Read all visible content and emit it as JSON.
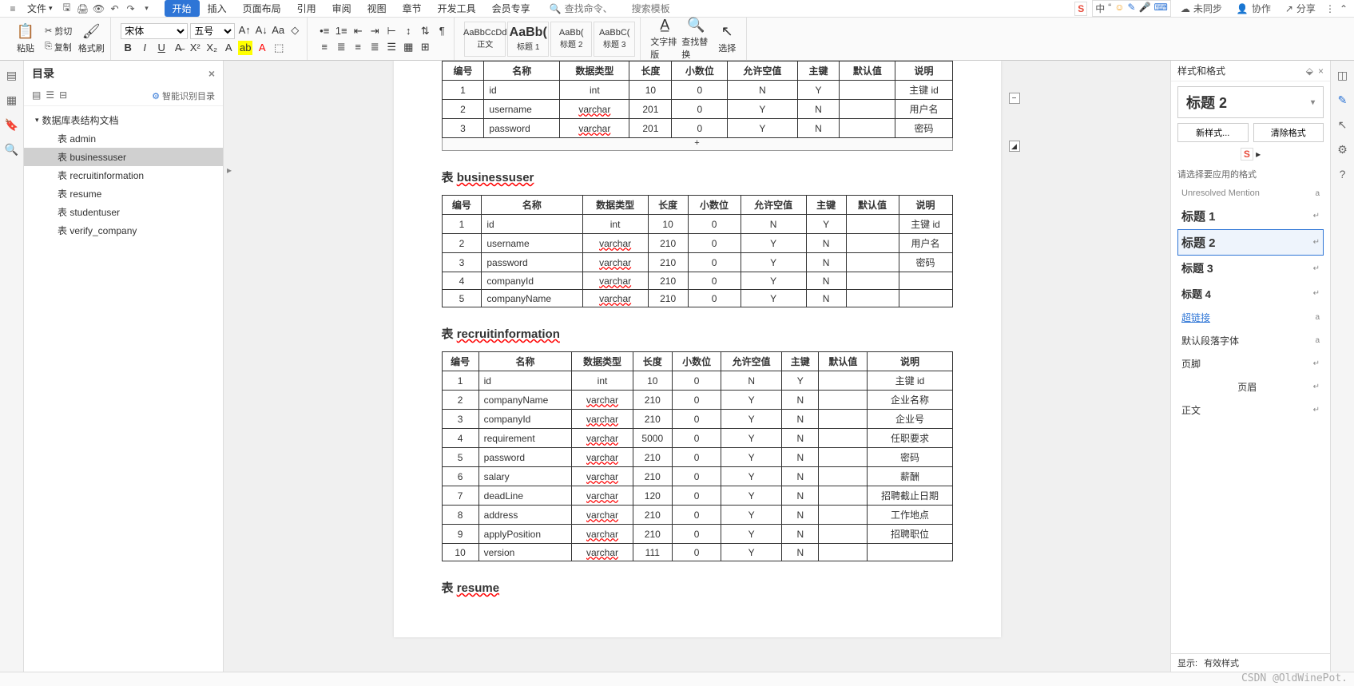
{
  "topMenu": {
    "fileLabel": "文件",
    "tabs": [
      "开始",
      "插入",
      "页面布局",
      "引用",
      "审阅",
      "视图",
      "章节",
      "开发工具",
      "会员专享"
    ],
    "activeTab": 0,
    "searchPlaceholder1": "查找命令、",
    "searchPlaceholder2": "搜索模板",
    "cloudSync": "未同步",
    "collaborate": "协作",
    "share": "分享"
  },
  "ribbon": {
    "paste": "粘贴",
    "cut": "剪切",
    "copy": "复制",
    "formatPainter": "格式刷",
    "fontName": "宋体",
    "fontSize": "五号",
    "styleGallery": [
      {
        "preview": "AaBbCcDd",
        "label": "正文"
      },
      {
        "preview": "AaBb(",
        "label": "标题 1"
      },
      {
        "preview": "AaBb(",
        "label": "标题 2"
      },
      {
        "preview": "AaBbC(",
        "label": "标题 3"
      }
    ],
    "textTools": "文字排版",
    "findReplace": "查找替换",
    "select": "选择"
  },
  "outline": {
    "title": "目录",
    "smartDetect": "智能识别目录",
    "root": "数据库表结构文档",
    "items": [
      "表 admin",
      "表 businessuser",
      "表 recruitinformation",
      "表 resume",
      "表 studentuser",
      "表 verify_company"
    ],
    "selectedIndex": 1
  },
  "doc": {
    "headers": [
      "编号",
      "名称",
      "数据类型",
      "长度",
      "小数位",
      "允许空值",
      "主键",
      "默认值",
      "说明"
    ],
    "tableAdmin": {
      "rows": [
        [
          "1",
          "id",
          "int",
          "10",
          "0",
          "N",
          "Y",
          "",
          "主键 id"
        ],
        [
          "2",
          "username",
          "varchar",
          "201",
          "0",
          "Y",
          "N",
          "",
          "用户名"
        ],
        [
          "3",
          "password",
          "varchar",
          "201",
          "0",
          "Y",
          "N",
          "",
          "密码"
        ]
      ]
    },
    "titleBusiness": "表",
    "titleBusinessName": "businessuser",
    "tableBusiness": {
      "rows": [
        [
          "1",
          "id",
          "int",
          "10",
          "0",
          "N",
          "Y",
          "",
          "主键 id"
        ],
        [
          "2",
          "username",
          "varchar",
          "210",
          "0",
          "Y",
          "N",
          "",
          "用户名"
        ],
        [
          "3",
          "password",
          "varchar",
          "210",
          "0",
          "Y",
          "N",
          "",
          "密码"
        ],
        [
          "4",
          "companyId",
          "varchar",
          "210",
          "0",
          "Y",
          "N",
          "",
          ""
        ],
        [
          "5",
          "companyName",
          "varchar",
          "210",
          "0",
          "Y",
          "N",
          "",
          ""
        ]
      ]
    },
    "titleRecruit": "表",
    "titleRecruitName": "recruitinformation",
    "tableRecruit": {
      "rows": [
        [
          "1",
          "id",
          "int",
          "10",
          "0",
          "N",
          "Y",
          "",
          "主键 id"
        ],
        [
          "2",
          "companyName",
          "varchar",
          "210",
          "0",
          "Y",
          "N",
          "",
          "企业名称"
        ],
        [
          "3",
          "companyId",
          "varchar",
          "210",
          "0",
          "Y",
          "N",
          "",
          "企业号"
        ],
        [
          "4",
          "requirement",
          "varchar",
          "5000",
          "0",
          "Y",
          "N",
          "",
          "任职要求"
        ],
        [
          "5",
          "password",
          "varchar",
          "210",
          "0",
          "Y",
          "N",
          "",
          "密码"
        ],
        [
          "6",
          "salary",
          "varchar",
          "210",
          "0",
          "Y",
          "N",
          "",
          "薪酬"
        ],
        [
          "7",
          "deadLine",
          "varchar",
          "120",
          "0",
          "Y",
          "N",
          "",
          "招聘截止日期"
        ],
        [
          "8",
          "address",
          "varchar",
          "210",
          "0",
          "Y",
          "N",
          "",
          "工作地点"
        ],
        [
          "9",
          "applyPosition",
          "varchar",
          "210",
          "0",
          "Y",
          "N",
          "",
          "招聘职位"
        ],
        [
          "10",
          "version",
          "varchar",
          "111",
          "0",
          "Y",
          "N",
          "",
          ""
        ]
      ]
    },
    "titleResume": "表",
    "titleResumeName": "resume"
  },
  "stylesPanel": {
    "title": "样式和格式",
    "currentStyle": "标题 2",
    "newStyle": "新样式...",
    "clearFormat": "清除格式",
    "hint": "请选择要应用的格式",
    "entries": [
      {
        "name": "Unresolved Mention",
        "cls": "small",
        "mark": "a"
      },
      {
        "name": "标题 1",
        "cls": "h1",
        "mark": "↵"
      },
      {
        "name": "标题 2",
        "cls": "h2",
        "mark": "↵",
        "selected": true
      },
      {
        "name": "标题 3",
        "cls": "h3",
        "mark": "↵"
      },
      {
        "name": "标题 4",
        "cls": "h4",
        "mark": "↵"
      },
      {
        "name": "超链接",
        "cls": "link",
        "mark": "a"
      },
      {
        "name": "默认段落字体",
        "cls": "",
        "mark": "a"
      },
      {
        "name": "页脚",
        "cls": "",
        "mark": "↵"
      },
      {
        "name": "页眉",
        "cls": "footer-h",
        "mark": "↵"
      },
      {
        "name": "正文",
        "cls": "",
        "mark": "↵"
      }
    ],
    "show": "显示:",
    "showValue": "有效样式"
  },
  "watermark": "CSDN @OldWinePot."
}
